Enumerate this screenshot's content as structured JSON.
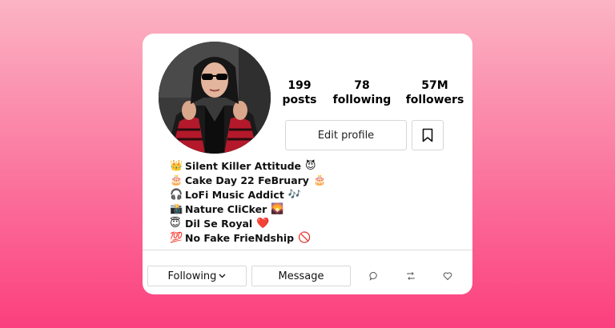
{
  "profile": {
    "stats": [
      {
        "value": "199",
        "label": "posts"
      },
      {
        "value": "78",
        "label": "following"
      },
      {
        "value": "57M",
        "label": "followers"
      }
    ],
    "edit_profile_label": "Edit profile",
    "bio": [
      {
        "emoji": "👑",
        "text": "Silent Killer Attitude",
        "emoji_after": "😈"
      },
      {
        "emoji": "🎂",
        "text": "Cake Day 22 FeBruary",
        "emoji_after": "🎂"
      },
      {
        "emoji": "🎧",
        "text": "LoFi Music Addict",
        "emoji_after": "🎶"
      },
      {
        "emoji": "📸",
        "text": "Nature CliCker",
        "emoji_after": "🌄"
      },
      {
        "emoji": "😇",
        "text": "Dil Se Royal",
        "emoji_after": "❤️"
      },
      {
        "emoji": "💯",
        "text": "No Fake FrieNdship",
        "emoji_after": "🚫"
      }
    ]
  },
  "actions": {
    "following_label": "Following",
    "message_label": "Message"
  },
  "colors": {
    "background_top": "#fbb4c4",
    "background_bottom": "#fb3f7e",
    "card": "#ffffff"
  }
}
